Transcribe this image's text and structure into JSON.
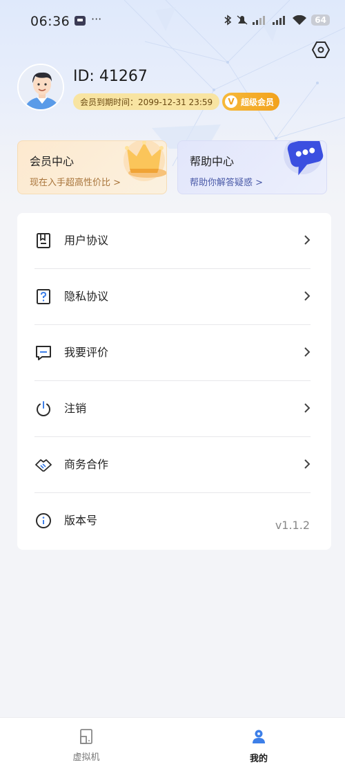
{
  "status_bar": {
    "time": "06:36",
    "dots": "···",
    "battery": "64"
  },
  "profile": {
    "id_text": "ID: 41267",
    "expire_text": "会员到期时间：2099-12-31 23:59",
    "vip_letter": "V",
    "vip_label": "超级会员"
  },
  "cards": {
    "member": {
      "title": "会员中心",
      "subtitle": "现在入手超高性价比 >"
    },
    "help": {
      "title": "帮助中心",
      "subtitle": "帮助你解答疑惑 >"
    }
  },
  "menu": {
    "items": [
      {
        "label": "用户协议",
        "icon": "document-icon"
      },
      {
        "label": "隐私协议",
        "icon": "question-icon"
      },
      {
        "label": "我要评价",
        "icon": "comment-icon"
      },
      {
        "label": "注销",
        "icon": "power-icon"
      },
      {
        "label": "商务合作",
        "icon": "handshake-icon"
      },
      {
        "label": "版本号",
        "icon": "info-icon",
        "value": "v1.1.2"
      }
    ]
  },
  "bottom_nav": {
    "items": [
      {
        "label": "虚拟机",
        "active": false
      },
      {
        "label": "我的",
        "active": true
      }
    ]
  },
  "colors": {
    "accent_blue": "#3d7fe8",
    "vip_gold": "#f2a21d",
    "background": "#f3f4f8"
  }
}
